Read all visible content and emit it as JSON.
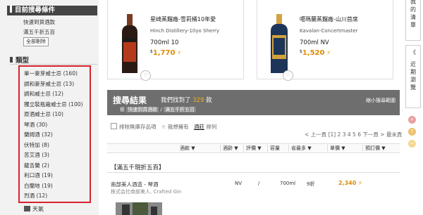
{
  "sidebar": {
    "criteria_title": "目前搜尋條件",
    "criteria": [
      "快速到貨酒款",
      "滿五千折五百"
    ],
    "clear_label": "全部刪除",
    "type_title": "類型",
    "types": [
      {
        "label": "單一麥芽威士忌 (160)"
      },
      {
        "label": "調和麥芽威士忌 (13)"
      },
      {
        "label": "調和威士忌 (12)"
      },
      {
        "label": "獨立裝瓶廠威士忌 (100)"
      },
      {
        "label": "原酒威士忌 (10)"
      },
      {
        "label": "琴酒 (30)"
      },
      {
        "label": "蘭姆酒 (32)"
      },
      {
        "label": "伏特加 (8)"
      },
      {
        "label": "苦艾酒 (3)"
      },
      {
        "label": "龍舌蘭 (2)"
      },
      {
        "label": "利口酒 (19)"
      },
      {
        "label": "白蘭地 (19)"
      },
      {
        "label": "烈酒 (12)"
      }
    ],
    "weather_label": "天氣"
  },
  "products": [
    {
      "name": "星崎蒸餾廠-雪莉桶10年愛",
      "name_en": "Hinch Distillery-10yo Sherry",
      "spec": "700ml   10",
      "currency": "$",
      "price": "1,770",
      "bottle_color": "#2b1a14",
      "label_color": "#b53a1c"
    },
    {
      "name": "噶瑪蘭蒸餾廠-山川首席",
      "name_en": "Kavalan-Concertmaster",
      "spec": "700ml   NV",
      "currency": "$",
      "price": "1,520",
      "bottle_color": "#1d3559",
      "label_color": "#d4a23c"
    }
  ],
  "results": {
    "title": "搜尋結果",
    "found_prefix": "我們找到了",
    "found_count": "329",
    "found_suffix": "款",
    "criteria_prefix": "依",
    "criteria_1": "快速到貨酒款",
    "criteria_sep": "/",
    "criteria_2": "滿五千折五百",
    "narrow_label": "縮小搜尋範圍"
  },
  "options": {
    "exclude_label": "排除無庫存品項",
    "star_icon": "☆",
    "favorites_label": "我想擁有",
    "sort_active": "酒莊",
    "sort_suffix": "排列"
  },
  "pager": {
    "prev": "< 上一頁",
    "page_1": "[1]",
    "pages": "2 3 4 5 6",
    "next": "下一頁 >",
    "last": "最末頁",
    "end": ">>"
  },
  "table_header": [
    "酒款 ▼",
    "酒齡 ▼",
    "評價 ▼",
    "容量",
    "省最多 ▼",
    "單價 ▼",
    "預訂價 ▼"
  ],
  "promo_title": "【滿五千現折五百】",
  "rows": [
    {
      "name": "南部美人酒造 - 琴酒",
      "company": "株式会社南部美人, Crafted Gin",
      "age": "NV",
      "rating": "/",
      "volume": "700ml",
      "discount": "9折",
      "price": "2,340"
    }
  ],
  "right_tabs": [
    {
      "chars": [
        "我",
        "的",
        "清",
        "單"
      ]
    },
    {
      "chars": [
        "《",
        "近",
        "期",
        "瀏",
        "覽"
      ]
    }
  ],
  "colors": {
    "accent": "#e08a00",
    "highlight": "#d9232d",
    "bar": "#6e6e6e"
  }
}
